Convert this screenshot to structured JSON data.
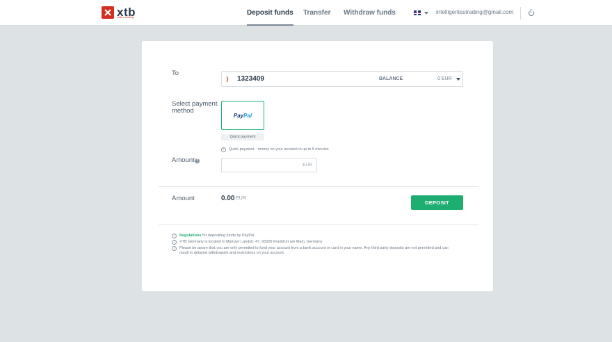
{
  "header": {
    "logo_text": "xtb",
    "logo_sub": "online trading",
    "nav": [
      {
        "label": "Deposit funds",
        "active": true
      },
      {
        "label": "Transfer",
        "active": false
      },
      {
        "label": "Withdraw funds",
        "active": false
      }
    ],
    "language_icon": "uk-flag-icon",
    "email": "intelligentestrading@gmail.com",
    "logout_icon": "power-icon"
  },
  "form": {
    "to_label": "To",
    "account": {
      "number": "1323409",
      "balance_label": "BALANCE",
      "balance_value": "0 EUR"
    },
    "payment_label": "Select payment method",
    "payment_method": {
      "name_part1": "Pay",
      "name_part2": "Pal",
      "badge": "Quick payment"
    },
    "quick_note": "Quick payment - money on your account in up to 5 minutes",
    "amount_label": "Amount",
    "amount_input": {
      "value": "",
      "currency": "EUR"
    },
    "total_label": "Amount",
    "total_value": "0.00",
    "total_currency": "EUR",
    "deposit_label": "DEPOSIT"
  },
  "footer": {
    "regulations_link": "Regulations",
    "regulations_rest": " for depositing funds by PayPal.",
    "address": "XTB Germany is located in Mainzer Landstr. 47, 60329 Frankfurt am Main, Germany",
    "notice_line1": "Please be aware that you are only permitted to fund your account from a bank account or card in your name. Any third party deposits are not permitted and can",
    "notice_line2": "result in delayed withdrawals and restrictions on your account."
  },
  "colors": {
    "accent": "#1fae72",
    "brand": "#d62d20",
    "background": "#dde2e5"
  }
}
